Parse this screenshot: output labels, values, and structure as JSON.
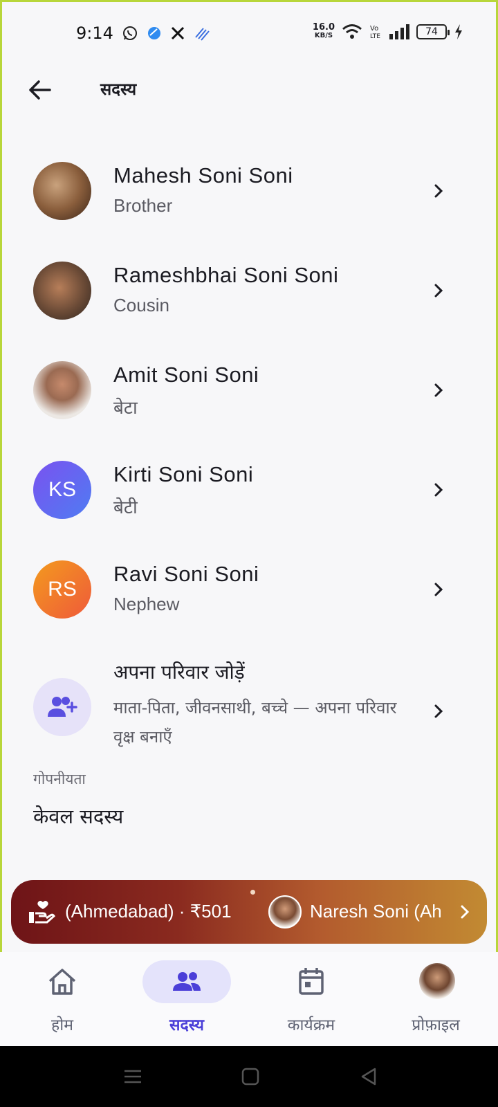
{
  "status_bar": {
    "time": "9:14",
    "speed_value": "16.0",
    "speed_unit": "KB/S",
    "battery": "74",
    "icons": [
      "whatsapp-icon",
      "app-icon",
      "x-icon",
      "signal-app-icon",
      "wifi-icon",
      "volte-icon",
      "cell-signal-icon",
      "charging-icon"
    ]
  },
  "header": {
    "title": "सदस्य",
    "back_icon": "arrow-left-icon"
  },
  "members": [
    {
      "name": "Mahesh Soni Soni",
      "relation": "Brother",
      "avatar": "photo"
    },
    {
      "name": "Rameshbhai Soni Soni",
      "relation": "Cousin",
      "avatar": "photo"
    },
    {
      "name": "Amit Soni Soni",
      "relation": "बेटा",
      "avatar": "photo"
    },
    {
      "name": "Kirti Soni Soni",
      "relation": "बेटी",
      "avatar": "KS",
      "avatar_color": "#6a66f1"
    },
    {
      "name": "Ravi Soni Soni",
      "relation": "Nephew",
      "avatar": "RS",
      "avatar_color": "#f2722b"
    }
  ],
  "add_family": {
    "title": "अपना परिवार जोड़ें",
    "subtitle": "माता-पिता, जीवनसाथी, बच्चे — अपना परिवार वृक्ष बनाएँ",
    "icon": "add-user-icon"
  },
  "privacy": {
    "label": "गोपनीयता",
    "value": "केवल सदस्य"
  },
  "banner": {
    "text": "(Ahmedabad) · ₹501",
    "name": "Naresh Soni (Ah",
    "icon": "donation-hand-icon"
  },
  "bottom_nav": [
    {
      "label": "होम",
      "icon": "home-icon",
      "active": false
    },
    {
      "label": "सदस्य",
      "icon": "members-icon",
      "active": true
    },
    {
      "label": "कार्यक्रम",
      "icon": "calendar-icon",
      "active": false
    },
    {
      "label": "प्रोफ़ाइल",
      "icon": "profile-avatar",
      "active": false
    }
  ],
  "colors": {
    "accent": "#4b3fd8",
    "active_pill": "#e4e3fb",
    "banner_start": "#6e1417",
    "banner_end": "#c28a32"
  }
}
